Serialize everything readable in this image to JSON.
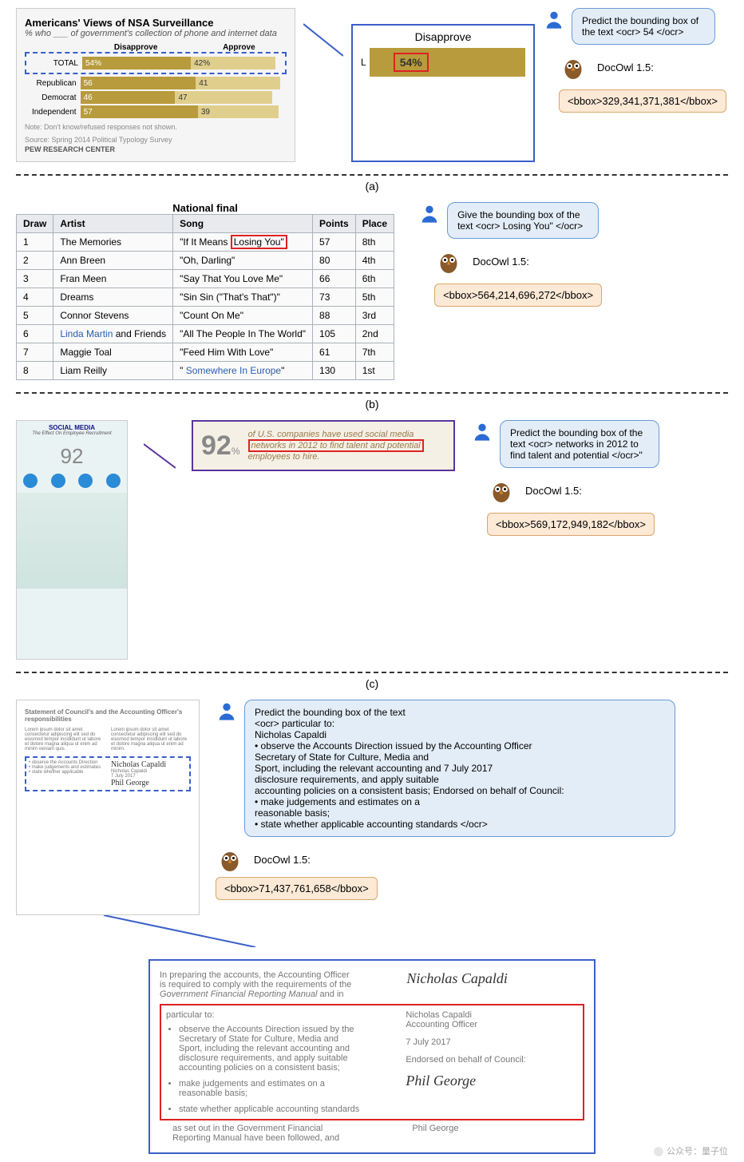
{
  "labels": {
    "a": "(a)",
    "b": "(b)",
    "c": "(c)"
  },
  "model_name": "DocOwl 1.5:",
  "a": {
    "chart": {
      "title": "Americans' Views of NSA Surveillance",
      "subtitle": "% who ___ of government's collection of phone and internet data",
      "head_disapprove": "Disapprove",
      "head_approve": "Approve",
      "rows": [
        {
          "label": "TOTAL",
          "d": "54%",
          "a": "42%",
          "dpct": 54,
          "apct": 42
        },
        {
          "label": "Republican",
          "d": "56",
          "a": "41",
          "dpct": 56,
          "apct": 41
        },
        {
          "label": "Democrat",
          "d": "46",
          "a": "47",
          "dpct": 46,
          "apct": 47
        },
        {
          "label": "Independent",
          "d": "57",
          "a": "39",
          "dpct": 57,
          "apct": 39
        }
      ],
      "note": "Note: Don't know/refused responses not shown.",
      "source": "Source: Spring 2014 Political Typology Survey",
      "org": "PEW RESEARCH CENTER"
    },
    "zoom": {
      "title": "Disapprove",
      "value": "54%",
      "left_letter": "L"
    },
    "prompt": "Predict the bounding box of the text <ocr> 54 </ocr>",
    "output": "<bbox>329,341,371,381</bbox>"
  },
  "b": {
    "caption": "National final",
    "headers": [
      "Draw",
      "Artist",
      "Song",
      "Points",
      "Place"
    ],
    "rows": [
      {
        "draw": "1",
        "artist": "The Memories",
        "song_pre": "\"If It Means ",
        "song_hl": "Losing You\"",
        "points": "57",
        "place": "8th"
      },
      {
        "draw": "2",
        "artist": "Ann Breen",
        "song": "\"Oh, Darling\"",
        "points": "80",
        "place": "4th"
      },
      {
        "draw": "3",
        "artist": "Fran Meen",
        "song": "\"Say That You Love Me\"",
        "points": "66",
        "place": "6th"
      },
      {
        "draw": "4",
        "artist": "Dreams",
        "song": "\"Sin Sin (\"That's That\")\"",
        "points": "73",
        "place": "5th"
      },
      {
        "draw": "5",
        "artist": "Connor Stevens",
        "song": "\"Count On Me\"",
        "points": "88",
        "place": "3rd"
      },
      {
        "draw": "6",
        "artist_link": "Linda Martin",
        "artist_suffix": " and Friends",
        "song": "\"All The People In The World\"",
        "points": "105",
        "place": "2nd"
      },
      {
        "draw": "7",
        "artist": "Maggie Toal",
        "song": "\"Feed Him With Love\"",
        "points": "61",
        "place": "7th"
      },
      {
        "draw": "8",
        "artist": "Liam Reilly",
        "song_quote": "\" ",
        "song_link": "Somewhere In Europe",
        "song_close": "\"",
        "points": "130",
        "place": "1st"
      }
    ],
    "prompt": "Give the bounding box of the text <ocr> Losing You\" </ocr>",
    "output": "<bbox>564,214,696,272</bbox>"
  },
  "c": {
    "info_title": "SOCIAL MEDIA",
    "info_sub": "The Effect On Employee Recruitment",
    "zoom": {
      "number": "92",
      "pct": "%",
      "line1": "of U.S. companies have used social media",
      "line_hl": "networks in 2012 to find talent and potential",
      "line3": "employees to hire."
    },
    "prompt": "Predict the bounding box of the text <ocr> networks in 2012 to find talent and potential </ocr>\"",
    "output": "<bbox>569,172,949,182</bbox>"
  },
  "d": {
    "doc_title": "Statement of Council's and the Accounting Officer's responsibilities",
    "prompt": "Predict the bounding box of the text\n<ocr> particular to:\nNicholas Capaldi\n• observe the Accounts Direction issued by the Accounting Officer\nSecretary of State for Culture, Media and\nSport, including the relevant accounting and 7 July 2017\ndisclosure requirements, and apply suitable\naccounting policies on a consistent basis; Endorsed on behalf of Council:\n• make judgements and estimates on a\nreasonable basis;\n• state whether applicable accounting standards </ocr>",
    "output": "<bbox>71,437,761,658</bbox>",
    "zoom": {
      "intro1": "In preparing the accounts, the Accounting Officer",
      "intro2": "is required to comply with the requirements of the",
      "intro3_i": "Government Financial Reporting Manual",
      "intro3_r": " and in",
      "pt": "particular to:",
      "b1a": "observe the Accounts Direction issued by the",
      "b1b": "Secretary of State for Culture, Media and",
      "b1c": "Sport, including the relevant accounting and",
      "b1d": "disclosure requirements, and apply suitable",
      "b1e": "accounting policies on a consistent basis;",
      "b2a": "make judgements and estimates on a",
      "b2b": "reasonable basis;",
      "b3": "state whether applicable accounting standards",
      "tail1": "as set out in the Government Financial",
      "tail2": "Reporting Manual have been followed, and",
      "sig1": "Nicholas Capaldi",
      "role1": "Accounting Officer",
      "date": "7 July 2017",
      "endorse": "Endorsed on behalf of Council:",
      "sig2": "Phil George",
      "sigimg1": "Nicholas Capaldi",
      "sigimg2": "Phil George"
    }
  },
  "watermark": "公众号：量子位"
}
